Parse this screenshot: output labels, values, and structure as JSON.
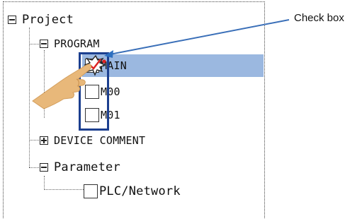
{
  "tree": {
    "root": {
      "label": "Project",
      "expander": "minus"
    },
    "program": {
      "label": "PROGRAM",
      "expander": "minus"
    },
    "items": [
      {
        "label": "MAIN",
        "checked": true,
        "selected": true
      },
      {
        "label": "M00",
        "checked": false,
        "selected": false
      },
      {
        "label": "M01",
        "checked": false,
        "selected": false
      }
    ],
    "device_comment": {
      "label": "DEVICE COMMENT",
      "expander": "plus"
    },
    "parameter": {
      "label": "Parameter",
      "expander": "minus"
    },
    "plc_network": {
      "label": "PLC/Network",
      "checked": false
    }
  },
  "callout": {
    "label": "Check box"
  },
  "colors": {
    "selection": "#9bb8e0",
    "highlight_border": "#1c3f8f",
    "arrow": "#2d6fc0",
    "leader_line": "#3a6fb8",
    "hand": "#e8b87a"
  }
}
